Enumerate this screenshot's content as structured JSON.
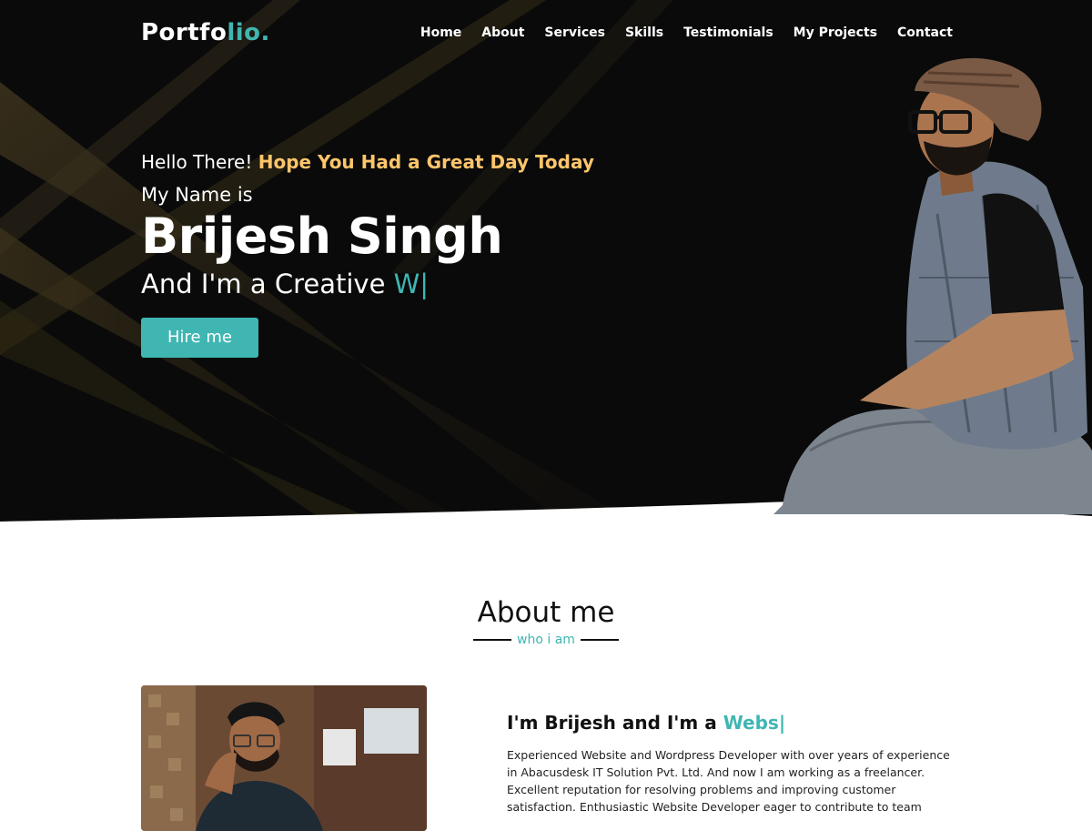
{
  "brand": {
    "logo_main": "Portfo",
    "logo_accent": "lio."
  },
  "nav": {
    "items": [
      "Home",
      "About",
      "Services",
      "Skills",
      "Testimonials",
      "My Projects",
      "Contact"
    ]
  },
  "hero": {
    "greeting": "Hello There!",
    "greeting_highlight": "Hope You Had a Great Day Today",
    "name_intro": "My Name is",
    "name": "Brijesh Singh",
    "role_prefix": "And I'm a Creative",
    "role_typed": "W|",
    "cta": "Hire me"
  },
  "about": {
    "title": "About me",
    "subtitle": "who i am",
    "heading_prefix": "I'm Brijesh and I'm a",
    "heading_typed": "Webs|",
    "paragraph": "Experienced Website and Wordpress Developer with over years of experience in Abacusdesk IT Solution Pvt. Ltd. And now I am working as a freelancer. Excellent reputation for resolving problems and improving customer satisfaction. Enthusiastic Website Developer eager to contribute to team"
  },
  "colors": {
    "accent": "#3fb6b2",
    "highlight": "#ffc56b",
    "hero_bg": "#0a0a0a"
  },
  "icons": {
    "hero_illustration": "person-illustration",
    "about_photo": "profile-photo"
  }
}
